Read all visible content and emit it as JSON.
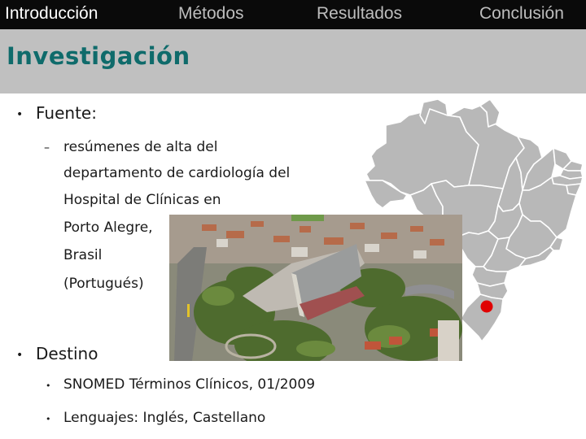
{
  "nav": {
    "items": [
      {
        "label": "Introducción",
        "active": true
      },
      {
        "label": "Métodos",
        "active": false
      },
      {
        "label": "Resultados",
        "active": false
      },
      {
        "label": "Conclusión",
        "active": false
      }
    ]
  },
  "slide": {
    "title": "Investigación",
    "bullets": [
      {
        "label": "Fuente:",
        "sub": {
          "lines": [
            "resúmenes de alta del",
            "departamento de cardiología del",
            "Hospital de Clínicas en",
            "Porto Alegre,",
            "Brasil",
            "(Portugués)"
          ]
        }
      },
      {
        "label": "Destino",
        "sub_items": [
          "SNOMED Términos Clínicos, 01/2009",
          "Lenguajes: Inglés, Castellano"
        ]
      }
    ]
  },
  "images": {
    "photo": {
      "description": "aerial-view-hospital-de-clinicas-porto-alegre"
    },
    "map": {
      "description": "map-of-brazil-states",
      "marker": "porto-alegre-location",
      "marker_color": "#e00000"
    }
  },
  "colors": {
    "nav_bg": "#0a0a0a",
    "nav_active": "#ffffff",
    "nav_inactive": "#bdbdbd",
    "title_band": "#c0c0c0",
    "title_text": "#0f6b6b",
    "map_fill": "#b8b8b8"
  }
}
